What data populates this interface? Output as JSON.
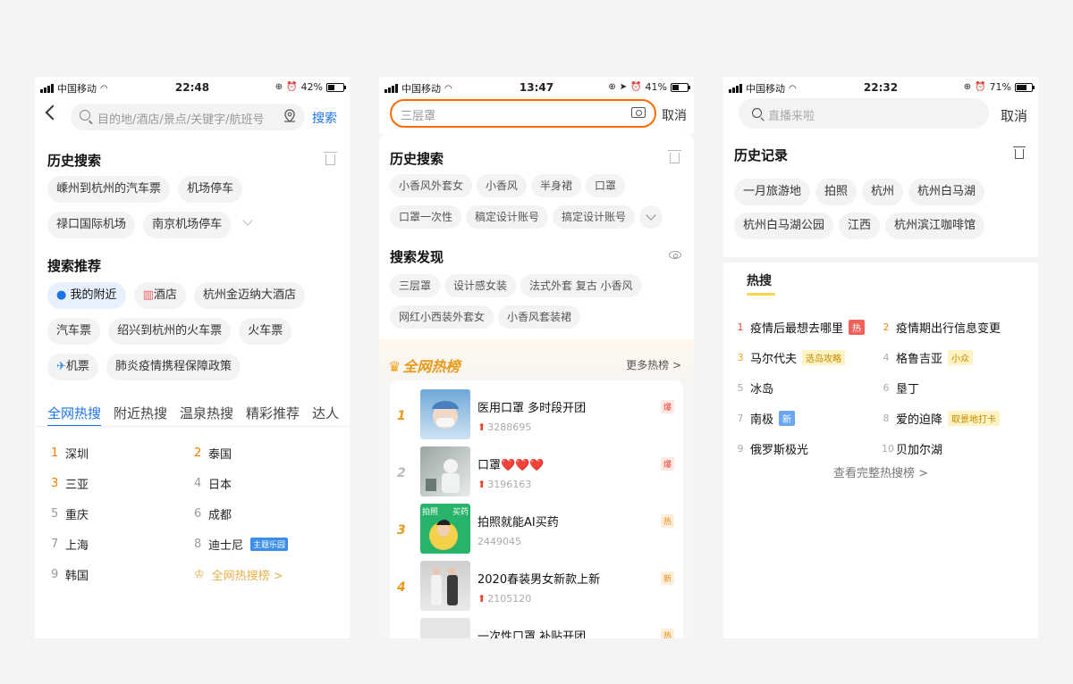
{
  "screens": [
    {
      "status": {
        "carrier": "中国移动",
        "time": "22:48",
        "battery": "42%",
        "battery_level": 0.42
      },
      "search": {
        "placeholder": "目的地/酒店/景点/关键字/航班号",
        "button": "搜索"
      },
      "history": {
        "title": "历史搜索",
        "items": [
          "嵊州到杭州的汽车票",
          "机场停车",
          "禄口国际机场",
          "南京机场停车"
        ]
      },
      "recommend": {
        "title": "搜索推荐",
        "items": [
          "我的附近",
          "酒店",
          "杭州金迈纳大酒店",
          "汽车票",
          "绍兴到杭州的火车票",
          "火车票",
          "机票",
          "肺炎疫情携程保障政策"
        ]
      },
      "tabs": [
        "全网热搜",
        "附近热搜",
        "温泉热搜",
        "精彩推荐",
        "达人"
      ],
      "hot": [
        {
          "n": "1",
          "t": "深圳"
        },
        {
          "n": "2",
          "t": "泰国"
        },
        {
          "n": "3",
          "t": "三亚"
        },
        {
          "n": "4",
          "t": "日本"
        },
        {
          "n": "5",
          "t": "重庆"
        },
        {
          "n": "6",
          "t": "成都"
        },
        {
          "n": "7",
          "t": "上海"
        },
        {
          "n": "8",
          "t": "迪士尼",
          "tag": "主题乐园"
        },
        {
          "n": "9",
          "t": "韩国"
        }
      ],
      "all_hot_link": "全网热搜榜 >"
    },
    {
      "status": {
        "carrier": "中国移动",
        "time": "13:47",
        "battery": "41%",
        "battery_level": 0.41
      },
      "search": {
        "placeholder": "三层罩",
        "cancel": "取消"
      },
      "history": {
        "title": "历史搜索",
        "items": [
          "小香风外套女",
          "小香风",
          "半身裙",
          "口罩",
          "口罩一次性",
          "稿定设计账号",
          "搞定设计账号"
        ]
      },
      "discover": {
        "title": "搜索发现",
        "items": [
          "三层罩",
          "设计感女装",
          "法式外套 复古 小香风",
          "网红小西装外套女",
          "小香风套装裙"
        ]
      },
      "rank": {
        "title": "全网热榜",
        "more": "更多热榜 >"
      },
      "list": [
        {
          "rank": "1",
          "title": "医用口罩 多时段开团",
          "count": "3288695",
          "badge": "爆",
          "up": true
        },
        {
          "rank": "2",
          "title": "口罩❤️❤️❤️",
          "count": "3196163",
          "badge": "爆",
          "up": true
        },
        {
          "rank": "3",
          "title": "拍照就能AI买药",
          "count": "2449045",
          "badge": "热",
          "up": false
        },
        {
          "rank": "4",
          "title": "2020春装男女新款上新",
          "count": "2105120",
          "badge": "新",
          "up": true
        },
        {
          "rank": "",
          "title": "一次性口罩 补贴开团",
          "count": "",
          "badge": "热",
          "up": false
        }
      ],
      "thumb_texts": [
        "拍照",
        "买药"
      ]
    },
    {
      "status": {
        "carrier": "中国移动",
        "time": "22:32",
        "battery": "71%",
        "battery_level": 0.71
      },
      "search": {
        "placeholder": "直播来啦",
        "cancel": "取消"
      },
      "history": {
        "title": "历史记录",
        "items": [
          "一月旅游地",
          "拍照",
          "杭州",
          "杭州白马湖",
          "杭州白马湖公园",
          "江西",
          "杭州滨江咖啡馆"
        ]
      },
      "hot_tab": "热搜",
      "hot": [
        {
          "n": "1",
          "t": "疫情后最想去哪里",
          "tag": "热",
          "tagType": "red",
          "numType": "r"
        },
        {
          "n": "2",
          "t": "疫情期出行信息变更",
          "numType": "o"
        },
        {
          "n": "3",
          "t": "马尔代夫",
          "tag": "选岛攻略",
          "tagType": "yel",
          "numType": "y"
        },
        {
          "n": "4",
          "t": "格鲁吉亚",
          "tag": "小众",
          "tagType": "yel"
        },
        {
          "n": "5",
          "t": "冰岛"
        },
        {
          "n": "6",
          "t": "垦丁"
        },
        {
          "n": "7",
          "t": "南极",
          "tag": "新",
          "tagType": "blue"
        },
        {
          "n": "8",
          "t": "爱的迫降",
          "tag": "取景地打卡",
          "tagType": "yel"
        },
        {
          "n": "9",
          "t": "俄罗斯极光"
        },
        {
          "n": "10",
          "t": "贝加尔湖"
        }
      ],
      "full_link": "查看完整热搜榜 >"
    }
  ]
}
